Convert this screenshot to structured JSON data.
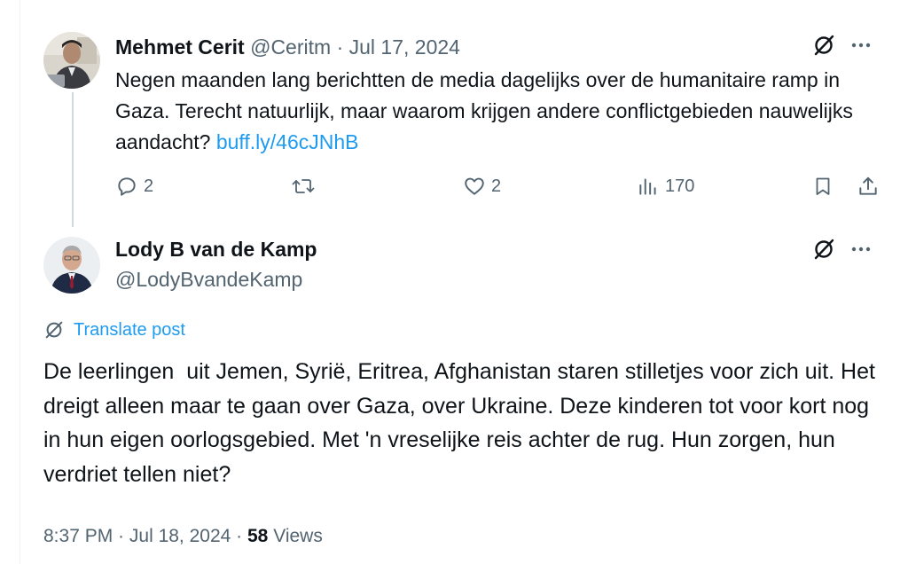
{
  "parent_tweet": {
    "author_name": "Mehmet Cerit",
    "handle": "@Ceritm",
    "separator": "·",
    "date": "Jul 17, 2024",
    "text": "Negen maanden lang berichtten de media dagelijks over de humanitaire ramp in Gaza. Terecht natuurlijk, maar waarom krijgen andere conflictgebieden nauwelijks aandacht? ",
    "link": "buff.ly/46cJNhB",
    "actions": {
      "replies": "2",
      "retweets": "",
      "likes": "2",
      "views": "170"
    }
  },
  "main_tweet": {
    "author_name": "Lody B van de Kamp",
    "handle": "@LodyBvandeKamp",
    "translate_label": "Translate post",
    "text": "De leerlingen  uit Jemen, Syrië, Eritrea, Afghanistan staren stilletjes voor zich uit. Het dreigt alleen maar te gaan over Gaza, over Ukraine. Deze kinderen tot voor kort nog in hun eigen oorlogsgebied. Met 'n vreselijke reis achter de rug. Hun zorgen, hun verdriet tellen niet?",
    "time": "8:37 PM",
    "separator1": " · ",
    "date": "Jul 18, 2024",
    "separator2": " · ",
    "views_count": "58",
    "views_label": " Views"
  },
  "icons": {
    "grok": "grok-icon",
    "more": "more-icon",
    "reply": "reply-icon",
    "retweet": "retweet-icon",
    "like": "like-icon",
    "views": "views-icon",
    "bookmark": "bookmark-icon",
    "share": "share-icon",
    "translate": "translate-icon"
  },
  "colors": {
    "text_primary": "#0f1419",
    "text_secondary": "#536471",
    "link": "#1d9bf0",
    "thread_line": "#cfd9de"
  }
}
